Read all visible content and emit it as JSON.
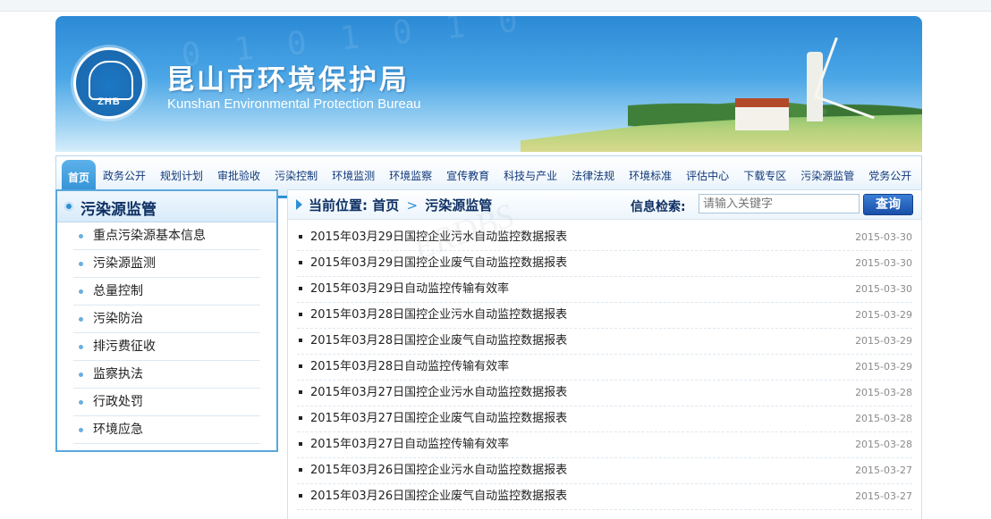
{
  "banner": {
    "title_cn": "昆山市环境保护局",
    "title_en": "Kunshan Environmental Protection Bureau",
    "logo_text": "ZHB"
  },
  "nav": {
    "items": [
      {
        "label": "首页",
        "active": true
      },
      {
        "label": "政务公开"
      },
      {
        "label": "规划计划"
      },
      {
        "label": "审批验收"
      },
      {
        "label": "污染控制"
      },
      {
        "label": "环境监测"
      },
      {
        "label": "环境监察"
      },
      {
        "label": "宣传教育"
      },
      {
        "label": "科技与产业"
      },
      {
        "label": "法律法规"
      },
      {
        "label": "环境标准"
      },
      {
        "label": "评估中心"
      },
      {
        "label": "下载专区"
      },
      {
        "label": "污染源监管"
      },
      {
        "label": "党务公开"
      }
    ]
  },
  "sidebar": {
    "title": "污染源监管",
    "items": [
      {
        "label": "重点污染源基本信息"
      },
      {
        "label": "污染源监测"
      },
      {
        "label": "总量控制"
      },
      {
        "label": "污染防治"
      },
      {
        "label": "排污费征收"
      },
      {
        "label": "监察执法"
      },
      {
        "label": "行政处罚"
      },
      {
        "label": "环境应急"
      }
    ]
  },
  "main": {
    "breadcrumb_label": "当前位置:",
    "breadcrumb_home": "首页",
    "breadcrumb_sep": ">",
    "breadcrumb_current": "污染源监管",
    "search_label": "信息检索:",
    "search_placeholder": "请输入关键字",
    "search_button": "查询",
    "articles": [
      {
        "title": "2015年03月29日国控企业污水自动监控数据报表",
        "date": "2015-03-30"
      },
      {
        "title": "2015年03月29日国控企业废气自动监控数据报表",
        "date": "2015-03-30"
      },
      {
        "title": "2015年03月29日自动监控传输有效率",
        "date": "2015-03-30"
      },
      {
        "title": "2015年03月28日国控企业污水自动监控数据报表",
        "date": "2015-03-29"
      },
      {
        "title": "2015年03月28日国控企业废气自动监控数据报表",
        "date": "2015-03-29"
      },
      {
        "title": "2015年03月28日自动监控传输有效率",
        "date": "2015-03-29"
      },
      {
        "title": "2015年03月27日国控企业污水自动监控数据报表",
        "date": "2015-03-28"
      },
      {
        "title": "2015年03月27日国控企业废气自动监控数据报表",
        "date": "2015-03-28"
      },
      {
        "title": "2015年03月27日自动监控传输有效率",
        "date": "2015-03-28"
      },
      {
        "title": "2015年03月26日国控企业污水自动监控数据报表",
        "date": "2015-03-27"
      },
      {
        "title": "2015年03月26日国控企业废气自动监控数据报表",
        "date": "2015-03-27"
      }
    ]
  }
}
